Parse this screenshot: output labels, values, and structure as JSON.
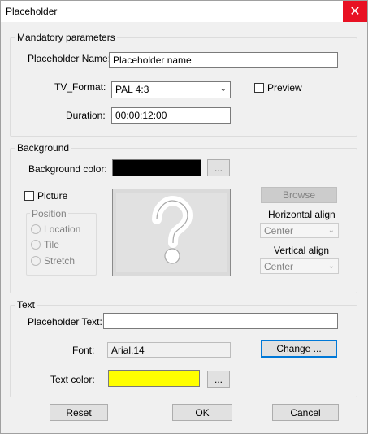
{
  "window": {
    "title": "Placeholder",
    "close_glyph": "✕"
  },
  "mandatory": {
    "group_label": "Mandatory parameters",
    "name_label": "Placeholder Name:",
    "name_value": "Placeholder name",
    "format_label": "TV_Format:",
    "format_value": "PAL 4:3",
    "preview_label": "Preview",
    "duration_label": "Duration:",
    "duration_value": "00:00:12:00"
  },
  "background": {
    "group_label": "Background",
    "color_label": "Background color:",
    "color_value": "#000000",
    "color_button": "...",
    "picture_label": "Picture",
    "position_label": "Position",
    "positions": [
      "Location",
      "Tile",
      "Stretch"
    ],
    "browse_button": "Browse",
    "h_align_label": "Horizontal align",
    "h_align_value": "Center",
    "v_align_label": "Vertical align",
    "v_align_value": "Center",
    "placeholder_glyph": "?"
  },
  "text": {
    "group_label": "Text",
    "placeholder_text_label": "Placeholder Text:",
    "placeholder_text_value": "",
    "font_label": "Font:",
    "font_value": "Arial,14",
    "change_button": "Change ...",
    "color_label": "Text color:",
    "color_value": "#ffff00",
    "color_button": "..."
  },
  "footer": {
    "reset": "Reset",
    "ok": "OK",
    "cancel": "Cancel"
  }
}
